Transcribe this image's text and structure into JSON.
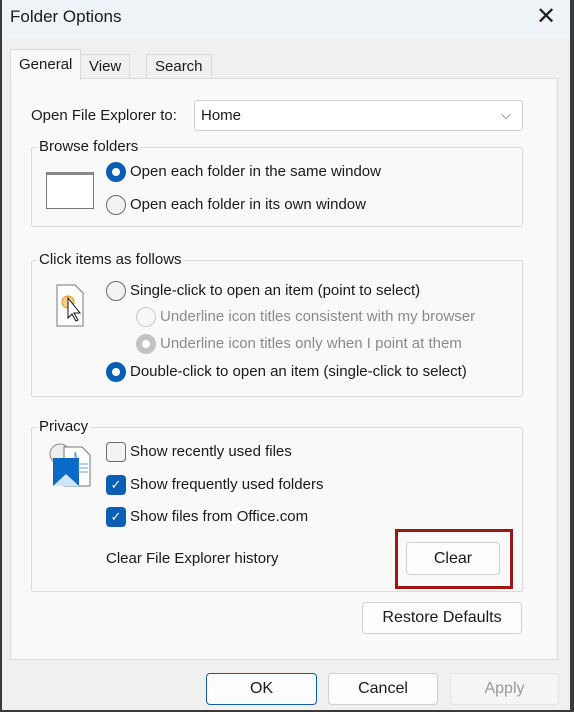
{
  "window": {
    "title": "Folder Options",
    "close_icon": "close-icon"
  },
  "tabs": [
    {
      "label": "General",
      "selected": true
    },
    {
      "label": "View"
    },
    {
      "label": "Search"
    }
  ],
  "open_explorer": {
    "label": "Open File Explorer to:",
    "value": "Home"
  },
  "browse": {
    "legend": "Browse folders",
    "options": [
      {
        "label": "Open each folder in the same window",
        "checked": true
      },
      {
        "label": "Open each folder in its own window",
        "checked": false
      }
    ]
  },
  "click": {
    "legend": "Click items as follows",
    "options": [
      {
        "label": "Single-click to open an item (point to select)",
        "checked": false
      },
      {
        "label": "Underline icon titles consistent with my browser",
        "checked": false,
        "disabled": true
      },
      {
        "label": "Underline icon titles only when I point at them",
        "checked": true,
        "disabled": true
      },
      {
        "label": "Double-click to open an item (single-click to select)",
        "checked": true
      }
    ]
  },
  "privacy": {
    "legend": "Privacy",
    "checks": [
      {
        "label": "Show recently used files",
        "checked": false
      },
      {
        "label": "Show frequently used folders",
        "checked": true
      },
      {
        "label": "Show files from Office.com",
        "checked": true
      }
    ],
    "clear_label": "Clear File Explorer history",
    "clear_button": "Clear",
    "highlight_color": "#a31515"
  },
  "restore_defaults": "Restore Defaults",
  "footer": {
    "ok": "OK",
    "cancel": "Cancel",
    "apply": "Apply"
  },
  "colors": {
    "accent": "#0a5fb4"
  }
}
